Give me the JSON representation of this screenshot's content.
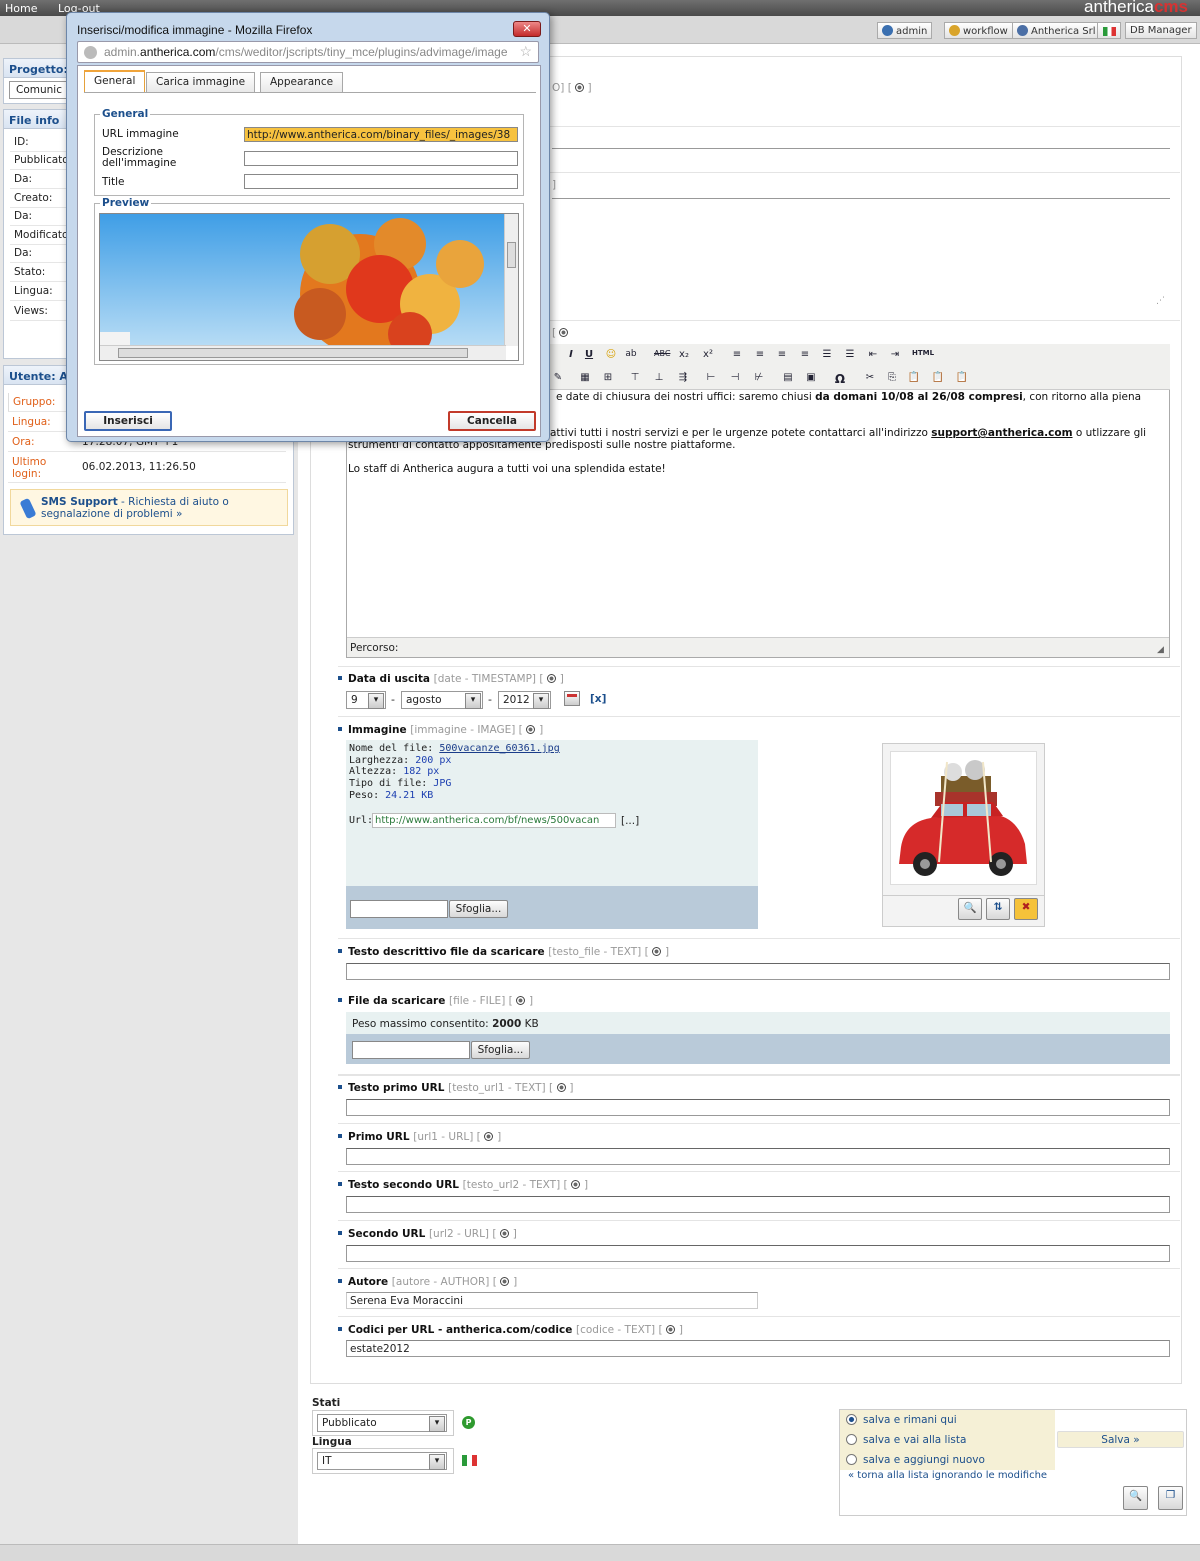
{
  "topbar": {
    "home": "Home",
    "logout": "Log-out",
    "brand_a": "antherica",
    "brand_b": "cms",
    "user": "admin",
    "workflow": "workflow",
    "company": "Antherica Srl",
    "db": "DB Manager"
  },
  "left": {
    "progetto_label": "Progetto:",
    "progetto_value": "Comunic",
    "fileinfo_label": "File info",
    "rows": [
      "ID:",
      "Pubblicato",
      "Da:",
      "Creato:",
      "Da:",
      "Modificato",
      "Da:",
      "Stato:",
      "Lingua:",
      "Views:"
    ],
    "utente_label": "Utente: An",
    "gruppo": "Gruppo:",
    "lingua": "Lingua:",
    "ora": "Ora:",
    "ora_value": "17:28:07, GMT +1",
    "ultimo": "Ultimo login:",
    "ultimo_value": "06.02.2013, 11:26.50",
    "sms_title": "SMS Support",
    "sms_text": " - Richiesta di aiuto o segnalazione di problemi »"
  },
  "dialog": {
    "title": "Inserisci/modifica immagine - Mozilla Firefox",
    "url_prefix": "admin.",
    "url_domain": "antherica.com",
    "url_rest": "/cms/weditor/jscripts/tiny_mce/plugins/advimage/image",
    "tabs": [
      "General",
      "Carica immagine",
      "Appearance"
    ],
    "general_legend": "General",
    "url_label": "URL immagine",
    "url_value": "http://www.antherica.com/binary_files/_images/38",
    "desc_label": "Descrizione dell'immagine",
    "title_label": "Title",
    "preview_legend": "Preview",
    "insert": "Inserisci",
    "cancel": "Cancella"
  },
  "main": {
    "field1_suffix": "O] [",
    "field3_suffix": "]",
    "editor_suffix": "[",
    "body": {
      "line1a": "e date di chiusura dei nostri uffici: saremo chiusi ",
      "line1b": "da domani 10/08 al 26/08 compresi",
      "line1c": ", con ritorno alla piena",
      "line2a": "attivi tutti i nostri servizi e per le urgenze potete contattarci all'indirizzo ",
      "line2b": "support@antherica.com",
      "line2c": " o utlizzare gli",
      "line3": "strumenti di contatto appositamente predisposti sulle nostre piattaforme.",
      "line4": "Lo staff di Antherica augura a tutti voi una splendida estate!"
    },
    "percorso": "Percorso:",
    "data_uscita": {
      "title": "Data di uscita",
      "meta": "[date - TIMESTAMP] [",
      "day": "9",
      "month": "agosto",
      "year": "2012",
      "clear": "[x]"
    },
    "immagine": {
      "title": "Immagine",
      "meta": "[immagine - IMAGE] [",
      "nome_label": "Nome del file: ",
      "nome": "500vacanze_60361.jpg",
      "larg_label": "Larghezza: ",
      "larg": "200 px",
      "alt_label": "Altezza: ",
      "alt": "182 px",
      "tipo_label": "Tipo di file: ",
      "tipo": "JPG",
      "peso_label": "Peso: ",
      "peso": "24.21 KB",
      "url_label": "Url: ",
      "url": "http://www.antherica.com/bf/news/500vacan",
      "more": "[...]",
      "browse": "Sfoglia..."
    },
    "testo_file": {
      "title": "Testo descrittivo file da scaricare",
      "meta": "[testo_file - TEXT] ["
    },
    "file": {
      "title": "File da scaricare",
      "meta": "[file - FILE] [",
      "max_label": "Peso massimo consentito: ",
      "max": "2000",
      "unit": " KB",
      "browse": "Sfoglia..."
    },
    "url1t": {
      "title": "Testo primo URL",
      "meta": "[testo_url1 - TEXT] ["
    },
    "url1": {
      "title": "Primo URL",
      "meta": "[url1 - URL] ["
    },
    "url2t": {
      "title": "Testo secondo URL",
      "meta": "[testo_url2 - TEXT] ["
    },
    "url2": {
      "title": "Secondo URL",
      "meta": "[url2 - URL] ["
    },
    "autore": {
      "title": "Autore",
      "meta": "[autore - AUTHOR] [",
      "value": "Serena Eva Moraccini"
    },
    "codice": {
      "title": "Codici per URL - antherica.com/codice",
      "meta": "[codice - TEXT] [",
      "value": "estate2012"
    },
    "close_bracket": "]"
  },
  "bottom": {
    "stati_label": "Stati",
    "stato_value": "Pubblicato",
    "lingua_label": "Lingua",
    "lingua_value": "IT",
    "opt1": "salva e rimani qui",
    "opt2": "salva e vai alla lista",
    "opt3": "salva e aggiungi nuovo",
    "save": "Salva »",
    "back": "« torna alla lista ignorando le modifiche"
  },
  "colors": {
    "accent": "#1c4f8c",
    "orange": "#e0601a",
    "brand_red": "#d63333"
  }
}
